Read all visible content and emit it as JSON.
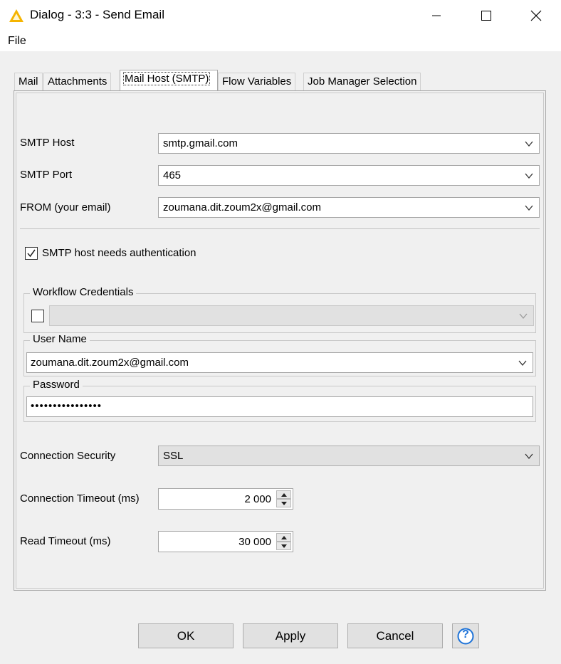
{
  "window": {
    "title": "Dialog - 3:3 - Send Email",
    "minimize_label": "—",
    "maximize_label": "☐",
    "close_label": "✕"
  },
  "menu": {
    "file": "File"
  },
  "tabs": [
    {
      "label": "Mail",
      "active": false
    },
    {
      "label": "Attachments",
      "active": false
    },
    {
      "label": "Mail Host (SMTP)",
      "active": true
    },
    {
      "label": "Flow Variables",
      "active": false
    },
    {
      "label": "Job Manager Selection",
      "active": false
    }
  ],
  "form": {
    "smtp_host_label": "SMTP Host",
    "smtp_host_value": "smtp.gmail.com",
    "smtp_port_label": "SMTP Port",
    "smtp_port_value": "465",
    "from_label": "FROM (your email)",
    "from_value": "zoumana.dit.zoum2x@gmail.com",
    "auth_label": "SMTP host needs authentication",
    "auth_checked": true,
    "workflow_credentials_title": "Workflow Credentials",
    "workflow_credentials_checked": false,
    "workflow_credentials_value": "",
    "user_name_title": "User Name",
    "user_name_value": "zoumana.dit.zoum2x@gmail.com",
    "password_title": "Password",
    "password_value": "••••••••••••••••",
    "connection_security_label": "Connection Security",
    "connection_security_value": "SSL",
    "connection_timeout_label": "Connection Timeout (ms)",
    "connection_timeout_value": "2 000",
    "read_timeout_label": "Read Timeout (ms)",
    "read_timeout_value": "30 000"
  },
  "buttons": {
    "ok": "OK",
    "apply": "Apply",
    "cancel": "Cancel",
    "help": "?"
  },
  "colors": {
    "app_icon": "#f5b400",
    "help_icon": "#1e73d8"
  }
}
